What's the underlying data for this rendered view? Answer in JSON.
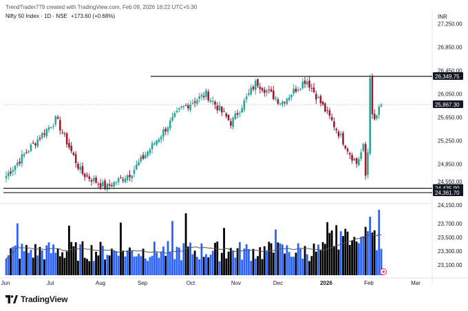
{
  "header": {
    "created_by": "TrendTrader779 created with TradingView.com, Feb 09, 2026 16:22 UTC+5:30",
    "symbol": "Nifty 50 Index · 1D · NSE",
    "change": "+173.60 (+0.68%)"
  },
  "currency": "INR",
  "brand": {
    "name": "TradingView"
  },
  "colors": {
    "up_candle": "#26a69a",
    "down_candle": "#a0182e",
    "volume_up": "#2962ff",
    "volume_down": "#000000",
    "volume_ma": "#555555",
    "grid_text": "#131722",
    "label_bg": "#131722",
    "accent_icon": "#e91e63"
  },
  "chart_data": {
    "type": "candlestick",
    "title": "",
    "x_ticks": [
      "Jun",
      "Jul",
      "Aug",
      "Sep",
      "Oct",
      "Nov",
      "Dec",
      "2026",
      "Feb",
      "Mar"
    ],
    "y_ticks": [
      27250,
      26850,
      26450,
      26050,
      25650,
      25250,
      24850,
      24550,
      24150,
      23700,
      23500,
      23300,
      23100
    ],
    "y_range": [
      24220,
      27420
    ],
    "price_labels": [
      {
        "text": "26,349.75",
        "value": 26349.75,
        "kind": "resistance"
      },
      {
        "text": "25,867.30",
        "value": 25867.3,
        "kind": "last"
      },
      {
        "text": "24,435.90",
        "value": 24435.9,
        "kind": "support"
      },
      {
        "text": "24,361.70",
        "value": 24361.7,
        "kind": "support"
      }
    ],
    "horizontal_levels": [
      26349.75,
      24435.9,
      24361.7
    ],
    "last_price": 25867.3,
    "volume_ma_visible": true,
    "series_anchors": [
      {
        "month": "Jun",
        "close": 24650
      },
      {
        "month": "mid-Jun",
        "close": 25150
      },
      {
        "month": "early-Jul",
        "close": 25620
      },
      {
        "month": "Aug",
        "close": 24700
      },
      {
        "month": "late-Aug",
        "close": 24450
      },
      {
        "month": "Sep",
        "close": 24700
      },
      {
        "month": "late-Sep",
        "close": 25250
      },
      {
        "month": "Oct",
        "close": 25800
      },
      {
        "month": "late-Oct",
        "close": 26050
      },
      {
        "month": "Nov",
        "close": 25550
      },
      {
        "month": "late-Nov",
        "close": 26250
      },
      {
        "month": "Dec",
        "close": 25900
      },
      {
        "month": "2026",
        "close": 26300
      },
      {
        "month": "mid-Jan",
        "close": 25600
      },
      {
        "month": "late-Jan",
        "close": 24850
      },
      {
        "month": "Feb",
        "close": 25867.3
      }
    ]
  }
}
